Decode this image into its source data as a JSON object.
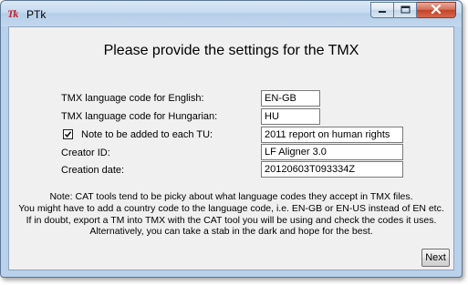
{
  "window": {
    "title": "PTk",
    "app_icon_text": "Tk"
  },
  "caption_buttons": {
    "minimize": "minimize-icon",
    "maximize": "maximize-icon",
    "close": "close-icon"
  },
  "heading": "Please provide the settings for the TMX",
  "form": {
    "english_code": {
      "label": "TMX language code for English:",
      "value": "EN-GB"
    },
    "hungarian_code": {
      "label": "TMX language code for Hungarian:",
      "value": "HU"
    },
    "note": {
      "label": "Note to be added to each TU:",
      "checked": true,
      "value": "2011 report on human rights"
    },
    "creator": {
      "label": "Creator ID:",
      "value": "LF Aligner 3.0"
    },
    "creation_date": {
      "label": "Creation date:",
      "value": "20120603T093334Z"
    }
  },
  "note_lines": [
    "Note: CAT tools tend to be picky about what language codes they accept in TMX files.",
    "You might have to add a country code to the language code, i.e. EN-GB or EN-US instead of EN etc.",
    "If in doubt, export a TM into TMX with the CAT tool you will be using and check the codes it uses.",
    "Alternatively, you can take a stab in the dark and hope for the best."
  ],
  "next_button": "Next",
  "colors": {
    "client_bg": "#f0f0f0",
    "frame_bg": "#b9d1ea",
    "close_button": "#c24327"
  }
}
